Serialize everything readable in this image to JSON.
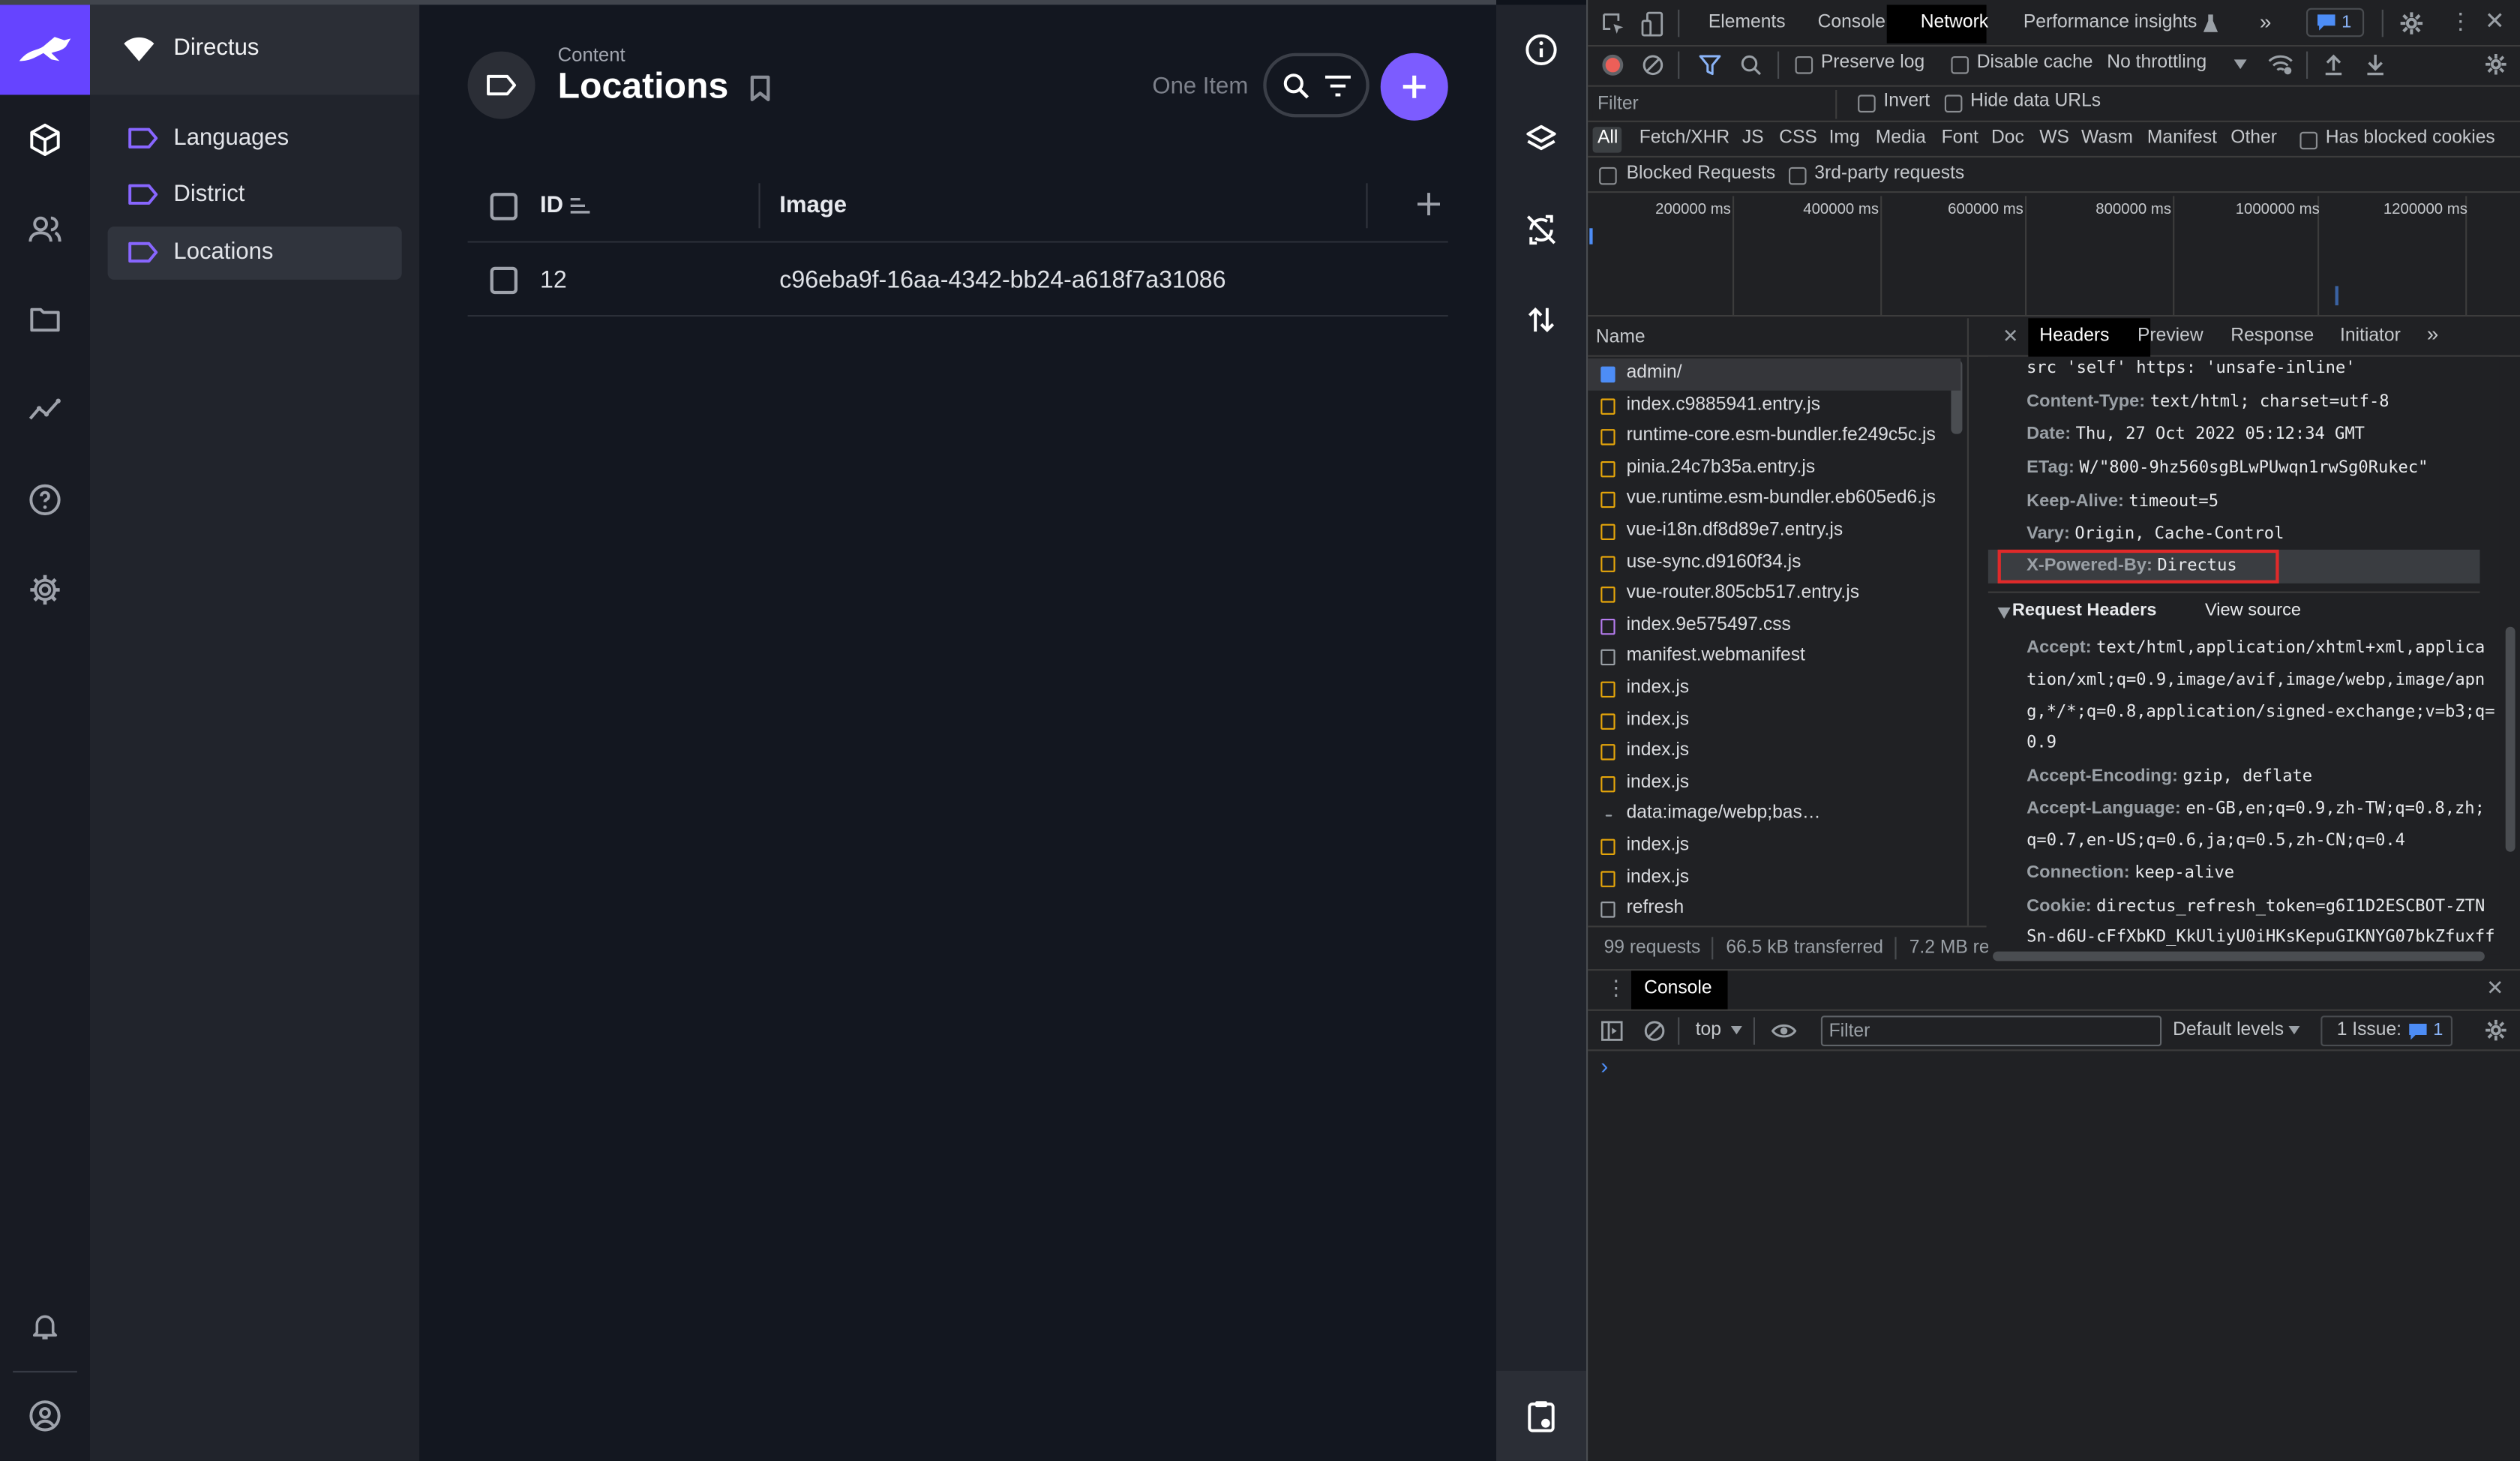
{
  "app": {
    "project_name": "Directus",
    "accent": "#6644ff"
  },
  "rail": {
    "icons": [
      "rabbit-logo-icon",
      "cube-icon",
      "users-icon",
      "folder-icon",
      "insights-icon",
      "help-icon",
      "settings-icon",
      "bell-icon",
      "user-circle-icon"
    ]
  },
  "nav": {
    "items": [
      {
        "label": "Languages",
        "active": false
      },
      {
        "label": "District",
        "active": false
      },
      {
        "label": "Locations",
        "active": true
      }
    ]
  },
  "header": {
    "breadcrumb": "Content",
    "title": "Locations",
    "item_count": "One Item"
  },
  "table": {
    "columns": [
      "ID",
      "Image"
    ],
    "rows": [
      {
        "id": "12",
        "image": "c96eba9f-16aa-4342-bb24-a618f7a31086"
      }
    ]
  },
  "devtools": {
    "tabs": [
      "Elements",
      "Console",
      "Network",
      "Performance insights"
    ],
    "active_tab": "Network",
    "issues_badge": "1",
    "toolbar": {
      "preserve_log": "Preserve log",
      "disable_cache": "Disable cache",
      "throttling": "No throttling"
    },
    "filter": {
      "placeholder": "Filter",
      "invert": "Invert",
      "hide_data_urls": "Hide data URLs"
    },
    "types": [
      "All",
      "Fetch/XHR",
      "JS",
      "CSS",
      "Img",
      "Media",
      "Font",
      "Doc",
      "WS",
      "Wasm",
      "Manifest",
      "Other"
    ],
    "has_blocked_cookies": "Has blocked cookies",
    "blocked_requests": "Blocked Requests",
    "third_party": "3rd-party requests",
    "timeline_ticks": [
      "200000 ms",
      "400000 ms",
      "600000 ms",
      "800000 ms",
      "1000000 ms",
      "1200000 ms"
    ],
    "name_header": "Name",
    "requests": [
      "admin/",
      "index.c9885941.entry.js",
      "runtime-core.esm-bundler.fe249c5c.js",
      "pinia.24c7b35a.entry.js",
      "vue.runtime.esm-bundler.eb605ed6.js",
      "vue-i18n.df8d89e7.entry.js",
      "use-sync.d9160f34.js",
      "vue-router.805cb517.entry.js",
      "index.9e575497.css",
      "manifest.webmanifest",
      "index.js",
      "index.js",
      "index.js",
      "index.js",
      "data:image/webp;bas…",
      "index.js",
      "index.js",
      "refresh"
    ],
    "status": {
      "requests": "99 requests",
      "transferred": "66.5 kB transferred",
      "resources": "7.2 MB re"
    },
    "detail_tabs": [
      "Headers",
      "Preview",
      "Response",
      "Initiator"
    ],
    "response_headers": [
      {
        "key": "",
        "value": "src 'self' https: 'unsafe-inline'"
      },
      {
        "key": "Content-Type:",
        "value": "text/html; charset=utf-8"
      },
      {
        "key": "Date:",
        "value": "Thu, 27 Oct 2022 05:12:34 GMT"
      },
      {
        "key": "ETag:",
        "value": "W/\"800-9hz560sgBLwPUwqn1rwSg0Rukec\""
      },
      {
        "key": "Keep-Alive:",
        "value": "timeout=5"
      },
      {
        "key": "Vary:",
        "value": "Origin, Cache-Control"
      },
      {
        "key": "X-Powered-By:",
        "value": "Directus"
      }
    ],
    "request_headers_title": "Request Headers",
    "view_source": "View source",
    "request_headers": [
      {
        "key": "Accept:",
        "lines": [
          "text/html,application/xhtml+xml,applica",
          "tion/xml;q=0.9,image/avif,image/webp,image/apn",
          "g,*/*;q=0.8,application/signed-exchange;v=b3;q=",
          "0.9"
        ]
      },
      {
        "key": "Accept-Encoding:",
        "lines": [
          "gzip, deflate"
        ]
      },
      {
        "key": "Accept-Language:",
        "lines": [
          "en-GB,en;q=0.9,zh-TW;q=0.8,zh;",
          "q=0.7,en-US;q=0.6,ja;q=0.5,zh-CN;q=0.4"
        ]
      },
      {
        "key": "Connection:",
        "lines": [
          "keep-alive"
        ]
      },
      {
        "key": "Cookie:",
        "lines": [
          "directus_refresh_token=g6I1D2ESCBOT-ZTN",
          "Sn-d6U-cFfXbKD_KkUliyU0iHKsKepuGIKNYG07bkZfuxff"
        ]
      }
    ],
    "console": {
      "tab": "Console",
      "context": "top",
      "filter_placeholder": "Filter",
      "levels": "Default levels",
      "issues": "1 Issue:",
      "issues_count": "1",
      "prompt": "›"
    }
  }
}
